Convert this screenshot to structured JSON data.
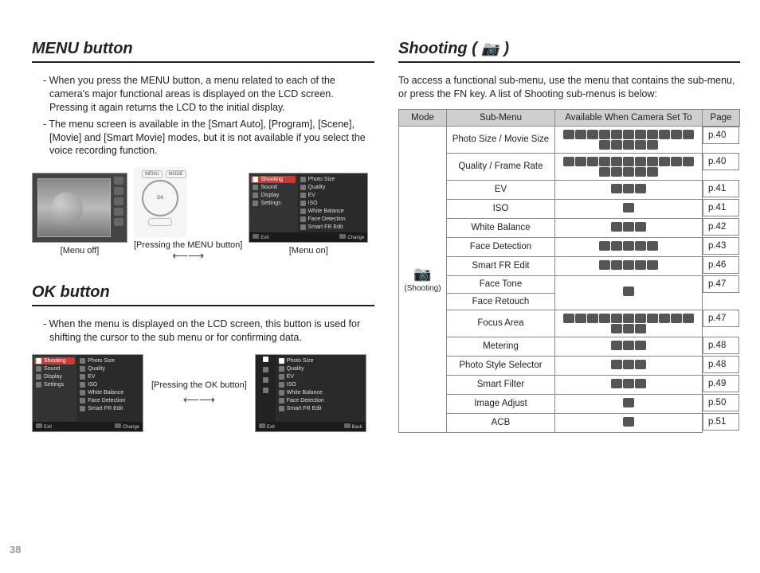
{
  "page_number": "38",
  "left": {
    "menu_heading": "MENU button",
    "menu_p1": "- When you press the MENU button, a menu related to each of the camera's major functional areas is displayed on the LCD screen. Pressing it again returns the LCD to the initial display.",
    "menu_p2": "- The menu screen is available in the [Smart Auto], [Program], [Scene], [Movie] and [Smart Movie] modes, but it is not available if you select the voice recording function.",
    "fig": {
      "pad_btn_left": "MENU",
      "pad_btn_right": "MODE",
      "pad_center": "OK",
      "pad_caption": "[Pressing the MENU button]",
      "arrow": "↔",
      "menu_off_caption": "[Menu off]",
      "menu_on_caption": "[Menu on]",
      "menu_left_items": [
        "Shooting",
        "Sound",
        "Display",
        "Settings"
      ],
      "menu_right_items": [
        "Photo Size",
        "Quality",
        "EV",
        "ISO",
        "White Balance",
        "Face Detection",
        "Smart FR Edit"
      ],
      "menu_bar_left": "Exit",
      "menu_bar_right": "Change"
    },
    "ok_heading": "OK button",
    "ok_p1": "- When the menu is displayed on the LCD screen, this button is used for shifting the cursor to the sub menu or for confirming data.",
    "ok_fig": {
      "caption_mid": "[Pressing the OK button]",
      "arrow": "↔",
      "menu1_left": [
        "Shooting",
        "Sound",
        "Display",
        "Settings"
      ],
      "menu1_right": [
        "Photo Size",
        "Quality",
        "EV",
        "ISO",
        "White Balance",
        "Face Detection",
        "Smart FR Edit"
      ],
      "menu1_bar_left": "Exit",
      "menu1_bar_right": "Change",
      "menu2_right": [
        "Photo Size",
        "Quality",
        "EV",
        "ISO",
        "White Balance",
        "Face Detection",
        "Smart FR Edit"
      ],
      "menu2_bar_left": "Exit",
      "menu2_bar_right": "Back"
    }
  },
  "right": {
    "heading_pre": "Shooting ( ",
    "heading_post": " )",
    "intro": "To access a functional sub-menu, use the menu that contains the sub-menu, or press the FN key. A list of Shooting sub-menus is below:",
    "th_mode": "Mode",
    "th_sub": "Sub-Menu",
    "th_avail": "Available When Camera Set To",
    "th_page": "Page",
    "mode_label": "(Shooting)",
    "rows": [
      {
        "sub": "Photo Size / Movie Size",
        "icons": 16,
        "page": "p.40"
      },
      {
        "sub": "Quality / Frame Rate",
        "icons": 16,
        "page": "p.40"
      },
      {
        "sub": "EV",
        "icons": 3,
        "page": "p.41"
      },
      {
        "sub": "ISO",
        "icons": 1,
        "page": "p.41"
      },
      {
        "sub": "White Balance",
        "icons": 3,
        "page": "p.42"
      },
      {
        "sub": "Face Detection",
        "icons": 5,
        "page": "p.43"
      },
      {
        "sub": "Smart FR Edit",
        "icons": 5,
        "page": "p.46"
      },
      {
        "sub": "Face Tone",
        "icons": 1,
        "page": "p.47",
        "merge_avail_below": true
      },
      {
        "sub": "Face Retouch",
        "icons": 0,
        "page": "",
        "merged": true
      },
      {
        "sub": "Focus Area",
        "icons": 14,
        "page": "p.47"
      },
      {
        "sub": "Metering",
        "icons": 3,
        "page": "p.48"
      },
      {
        "sub": "Photo Style Selector",
        "icons": 3,
        "page": "p.48"
      },
      {
        "sub": "Smart Filter",
        "icons": 3,
        "page": "p.49"
      },
      {
        "sub": "Image Adjust",
        "icons": 1,
        "page": "p.50"
      },
      {
        "sub": "ACB",
        "icons": 1,
        "page": "p.51"
      }
    ]
  }
}
